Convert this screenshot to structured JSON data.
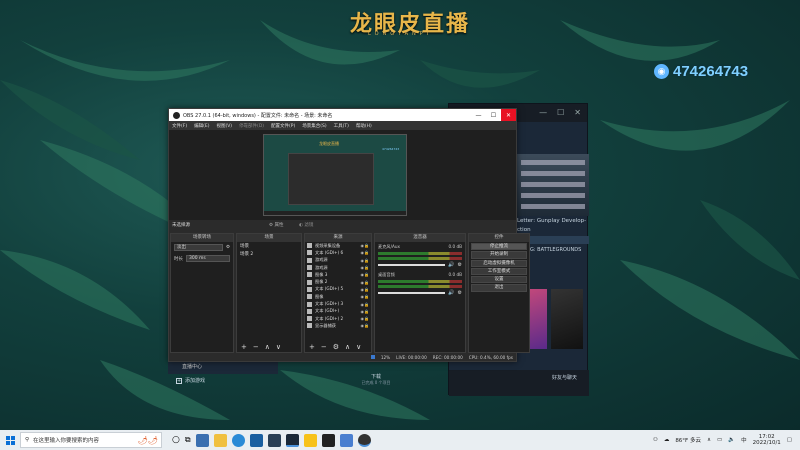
{
  "brand": {
    "title": "龙眼皮直播",
    "subtitle": "LONGYANPI"
  },
  "qq": {
    "icon": "qq-icon",
    "number": "474264743"
  },
  "steam": {
    "game_text": "Letter: Gunplay Develop-ction",
    "banner_text": "PUBG: BATTLEGROUNDS",
    "downloads": "下载",
    "downloads_sub": "已完成 0 个项目",
    "add_game": "添加游戏",
    "friends": "好友与聊天"
  },
  "obs": {
    "title": "OBS 27.0.1 (64-bit, windows) - 配置文件: 未命名 - 场景: 未命名",
    "menu": [
      "文件(F)",
      "编辑(E)",
      "视图(V)",
      "停靠部件(D)",
      "配置文件(P)",
      "场景集合(S)",
      "工具(T)",
      "帮助(H)"
    ],
    "context": {
      "selection": "未选择源",
      "properties": "属性",
      "filters": "滤镜"
    },
    "transitions": {
      "header": "场景转场",
      "type": "淡出",
      "duration_label": "时长",
      "duration_value": "300 ms"
    },
    "scenes": {
      "header": "场景",
      "items": [
        "场景",
        "场景 2"
      ]
    },
    "sources": {
      "header": "来源",
      "items": [
        "视频采集设备",
        "文本 (GDI+) 6",
        "游戏源",
        "游戏源",
        "图像 3",
        "图像 2",
        "文本 (GDI+) 5",
        "图像",
        "文本 (GDI+) 3",
        "文本 (GDI+)",
        "文本 (GDI+) 2",
        "显示器捕获"
      ]
    },
    "mixer": {
      "header": "混音器",
      "channels": [
        {
          "name": "麦克风/Aux",
          "value": "0.0 dB"
        },
        {
          "name": "桌面音频",
          "value": "0.0 dB"
        }
      ]
    },
    "controls": {
      "header": "控件",
      "buttons": [
        "停止推流",
        "开始录制",
        "启动虚拟摄像机",
        "工作室模式",
        "设置",
        "退出"
      ]
    },
    "status": {
      "dropped": "12%",
      "live": "LIVE: 00:00:00",
      "rec": "REC: 00:00:00",
      "cpu": "CPU: 0.4%, 60.00 fps"
    }
  },
  "obs_behind": "直播中心",
  "taskbar": {
    "search_placeholder": "在这里输入你要搜索的内容",
    "weather": "86°F 多云",
    "time": "17:02",
    "date": "2022/10/1",
    "lang": "中"
  }
}
